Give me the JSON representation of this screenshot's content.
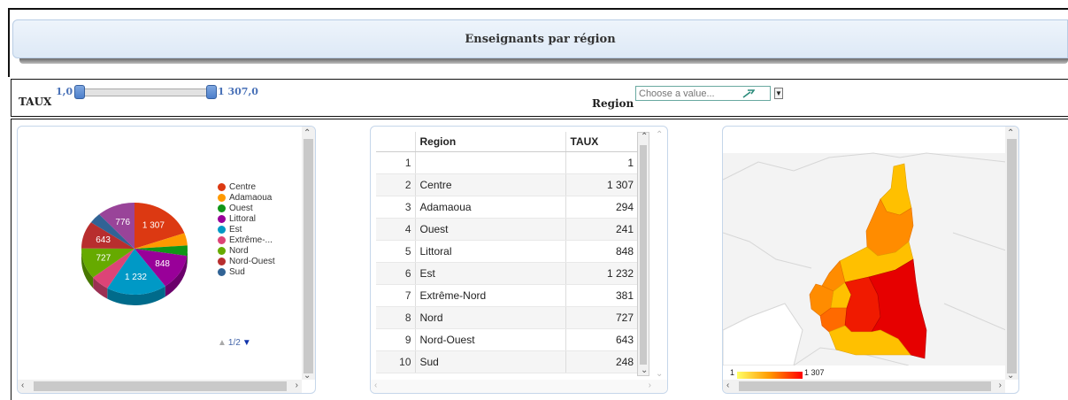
{
  "header": {
    "title": "Enseignants par région"
  },
  "filters": {
    "taux_label": "TAUX",
    "slider_min": "1,0",
    "slider_max": "1 307,0",
    "region_label": "Region",
    "region_placeholder": "Choose a value...",
    "range_min_value": 1,
    "range_max_value": 1307
  },
  "pie": {
    "slices": [
      {
        "name": "Centre",
        "value": 1307,
        "label": "1 307",
        "color": "#dc3912"
      },
      {
        "name": "Adamaoua",
        "value": 294,
        "label": "",
        "color": "#ff9900"
      },
      {
        "name": "Ouest",
        "value": 241,
        "label": "",
        "color": "#109618"
      },
      {
        "name": "Littoral",
        "value": 848,
        "label": "848",
        "color": "#990099"
      },
      {
        "name": "Est",
        "value": 1232,
        "label": "1 232",
        "color": "#0099c6"
      },
      {
        "name": "Extrême-Nord",
        "value": 381,
        "label": "",
        "color": "#dd4477"
      },
      {
        "name": "Nord",
        "value": 727,
        "label": "727",
        "color": "#66aa00"
      },
      {
        "name": "Nord-Ouest",
        "value": 643,
        "label": "643",
        "color": "#b82e2e"
      },
      {
        "name": "Sud",
        "value": 248,
        "label": "",
        "color": "#316395"
      },
      {
        "name": "",
        "value": 776,
        "label": "776",
        "color": "#994499"
      }
    ],
    "legend": [
      "Centre",
      "Adamaoua",
      "Ouest",
      "Littoral",
      "Est",
      "Extrême-...",
      "Nord",
      "Nord-Ouest",
      "Sud"
    ],
    "pager": "1/2"
  },
  "table": {
    "headers": [
      "Region",
      "TAUX"
    ],
    "rows": [
      {
        "idx": "1",
        "region": "",
        "taux": "1"
      },
      {
        "idx": "2",
        "region": "Centre",
        "taux": "1 307"
      },
      {
        "idx": "3",
        "region": "Adamaoua",
        "taux": "294"
      },
      {
        "idx": "4",
        "region": "Ouest",
        "taux": "241"
      },
      {
        "idx": "5",
        "region": "Littoral",
        "taux": "848"
      },
      {
        "idx": "6",
        "region": "Est",
        "taux": "1 232"
      },
      {
        "idx": "7",
        "region": "Extrême-Nord",
        "taux": "381"
      },
      {
        "idx": "8",
        "region": "Nord",
        "taux": "727"
      },
      {
        "idx": "9",
        "region": "Nord-Ouest",
        "taux": "643"
      },
      {
        "idx": "10",
        "region": "Sud",
        "taux": "248"
      }
    ]
  },
  "map": {
    "legend_min": "1",
    "legend_max": "1 307",
    "colors": {
      "low": "#ffff66",
      "mid": "#ff9900",
      "high": "#ff0000"
    }
  }
}
